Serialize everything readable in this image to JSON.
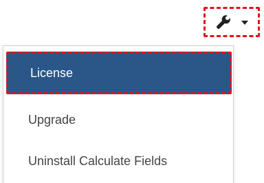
{
  "toolbar": {
    "settings_icon": "wrench-icon",
    "caret_icon": "chevron-down-icon",
    "highlight_color": "#e0121b"
  },
  "menu": {
    "active_color": "#2a5787",
    "items": [
      {
        "label": "License",
        "active": true
      },
      {
        "label": "Upgrade",
        "active": false
      },
      {
        "label": "Uninstall Calculate Fields",
        "active": false
      }
    ]
  }
}
